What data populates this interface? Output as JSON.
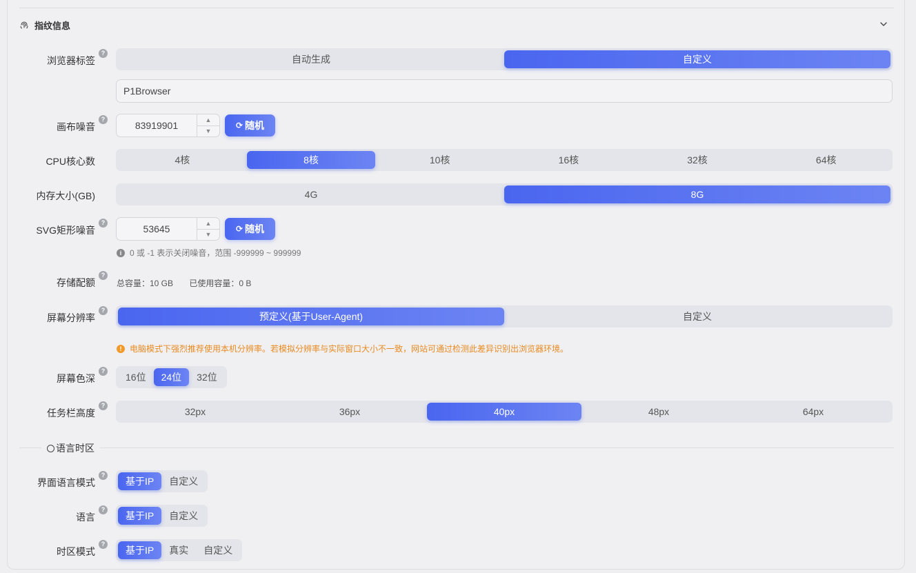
{
  "section": {
    "title": "指纹信息"
  },
  "browser_tag": {
    "label": "浏览器标签",
    "options": [
      "自动生成",
      "自定义"
    ],
    "selected": "自定义",
    "value": "P1Browser"
  },
  "canvas_noise": {
    "label": "画布噪音",
    "value": "83919901",
    "random_label": "随机"
  },
  "cpu": {
    "label": "CPU核心数",
    "options": [
      "4核",
      "8核",
      "10核",
      "16核",
      "32核",
      "64核"
    ],
    "selected": "8核"
  },
  "memory": {
    "label": "内存大小(GB)",
    "options": [
      "4G",
      "8G"
    ],
    "selected": "8G"
  },
  "svg_noise": {
    "label": "SVG矩形噪音",
    "value": "53645",
    "random_label": "随机",
    "hint": "0 或 -1 表示关闭噪音，范围 -999999 ~ 999999"
  },
  "storage": {
    "label": "存储配额",
    "total": "总容量：10 GB",
    "used": "已使用容量：0 B"
  },
  "resolution": {
    "label": "屏幕分辨率",
    "options": [
      "预定义(基于User-Agent)",
      "自定义"
    ],
    "selected": "预定义(基于User-Agent)",
    "warning": "电脑模式下强烈推荐使用本机分辨率。若模拟分辨率与实际窗口大小不一致，网站可通过检测此差异识别出浏览器环境。"
  },
  "color_depth": {
    "label": "屏幕色深",
    "options": [
      "16位",
      "24位",
      "32位"
    ],
    "selected": "24位"
  },
  "taskbar": {
    "label": "任务栏高度",
    "options": [
      "32px",
      "36px",
      "40px",
      "48px",
      "64px"
    ],
    "selected": "40px"
  },
  "lang_section": {
    "title": "语言时区"
  },
  "ui_lang_mode": {
    "label": "界面语言模式",
    "options": [
      "基于IP",
      "自定义"
    ],
    "selected": "基于IP"
  },
  "language": {
    "label": "语言",
    "options": [
      "基于IP",
      "自定义"
    ],
    "selected": "基于IP"
  },
  "timezone_mode": {
    "label": "时区模式",
    "options": [
      "基于IP",
      "真实",
      "自定义"
    ],
    "selected": "基于IP"
  },
  "colors": {
    "accent": "#4a66ef",
    "warning": "#e98a1f"
  }
}
